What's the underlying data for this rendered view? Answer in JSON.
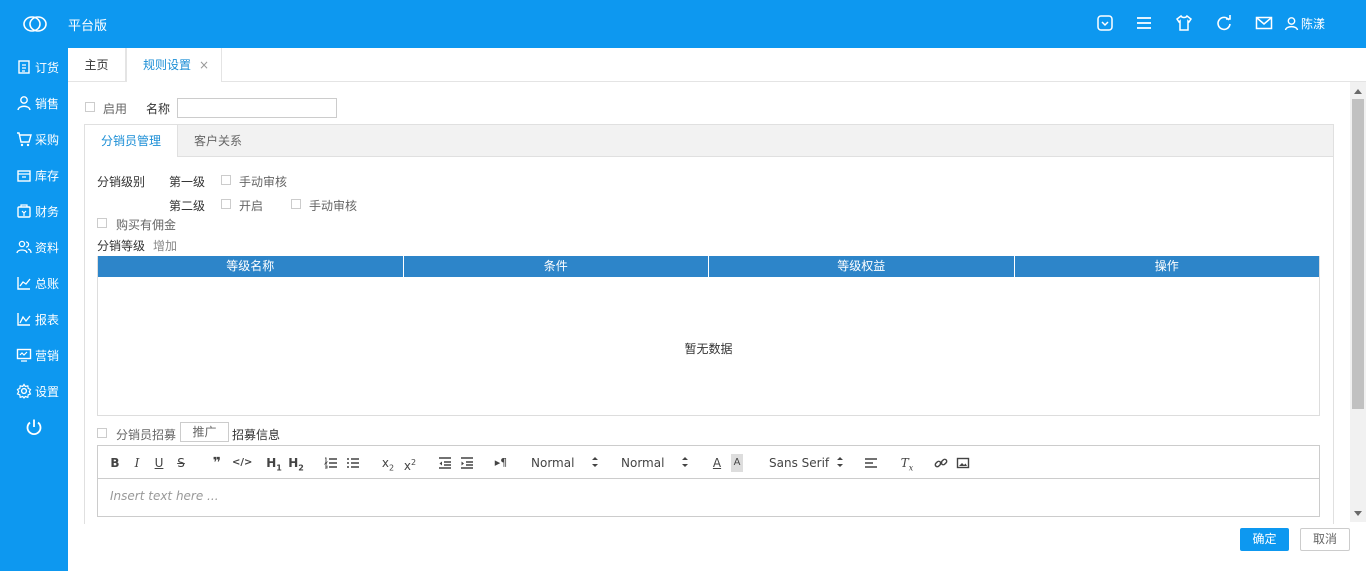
{
  "header": {
    "brand": "平台版",
    "user_name": "陈漾",
    "icons": [
      "logo-icon",
      "dashboard-icon",
      "menu-icon",
      "shirt-icon",
      "refresh-icon",
      "mail-icon",
      "user-icon"
    ]
  },
  "sidebar": {
    "items": [
      {
        "label": "订货",
        "icon": "clipboard-icon"
      },
      {
        "label": "销售",
        "icon": "person-icon"
      },
      {
        "label": "采购",
        "icon": "cart-icon"
      },
      {
        "label": "库存",
        "icon": "box-icon"
      },
      {
        "label": "财务",
        "icon": "wallet-icon"
      },
      {
        "label": "资料",
        "icon": "people-icon"
      },
      {
        "label": "总账",
        "icon": "chart-icon"
      },
      {
        "label": "报表",
        "icon": "report-icon"
      },
      {
        "label": "营销",
        "icon": "monitor-icon"
      },
      {
        "label": "设置",
        "icon": "gear-icon"
      }
    ],
    "power_icon": "power-icon"
  },
  "tabs": {
    "home": "主页",
    "active": "规则设置",
    "close": "×"
  },
  "form": {
    "enable_label": "启用",
    "name_label": "名称",
    "name_value": ""
  },
  "panel": {
    "tabs": [
      "分销员管理",
      "客户关系"
    ],
    "level_label": "分销级别",
    "level1_label": "第一级",
    "level1_manual": "手动审核",
    "level2_label": "第二级",
    "level2_open": "开启",
    "level2_manual": "手动审核",
    "buy_commission": "购买有佣金",
    "grade_label": "分销等级",
    "add_link": "增加",
    "table": {
      "columns": [
        "等级名称",
        "条件",
        "等级权益",
        "操作"
      ],
      "empty_text": "暂无数据"
    },
    "recruit_label": "分销员招募",
    "promo_button": "推广",
    "recruit_info": "招募信息"
  },
  "editor": {
    "heading_select": "Normal",
    "size_select": "Normal",
    "font_select": "Sans Serif",
    "placeholder": "Insert text here ..."
  },
  "actions": {
    "ok": "确定",
    "cancel": "取消"
  }
}
